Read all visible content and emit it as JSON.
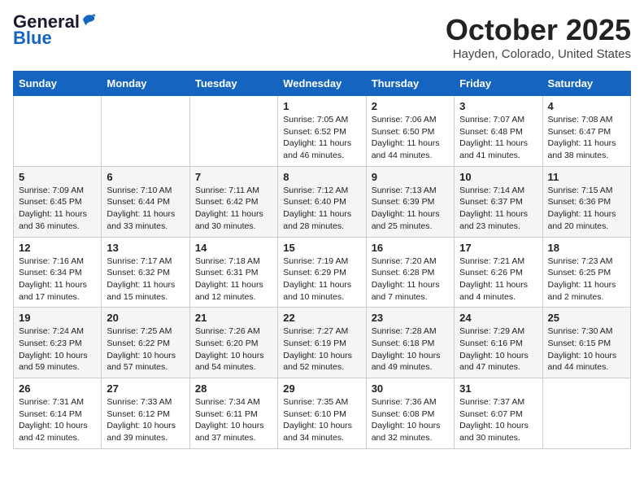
{
  "header": {
    "logo_general": "General",
    "logo_blue": "Blue",
    "month_title": "October 2025",
    "location": "Hayden, Colorado, United States"
  },
  "weekdays": [
    "Sunday",
    "Monday",
    "Tuesday",
    "Wednesday",
    "Thursday",
    "Friday",
    "Saturday"
  ],
  "weeks": [
    [
      {
        "day": "",
        "info": ""
      },
      {
        "day": "",
        "info": ""
      },
      {
        "day": "",
        "info": ""
      },
      {
        "day": "1",
        "info": "Sunrise: 7:05 AM\nSunset: 6:52 PM\nDaylight: 11 hours and 46 minutes."
      },
      {
        "day": "2",
        "info": "Sunrise: 7:06 AM\nSunset: 6:50 PM\nDaylight: 11 hours and 44 minutes."
      },
      {
        "day": "3",
        "info": "Sunrise: 7:07 AM\nSunset: 6:48 PM\nDaylight: 11 hours and 41 minutes."
      },
      {
        "day": "4",
        "info": "Sunrise: 7:08 AM\nSunset: 6:47 PM\nDaylight: 11 hours and 38 minutes."
      }
    ],
    [
      {
        "day": "5",
        "info": "Sunrise: 7:09 AM\nSunset: 6:45 PM\nDaylight: 11 hours and 36 minutes."
      },
      {
        "day": "6",
        "info": "Sunrise: 7:10 AM\nSunset: 6:44 PM\nDaylight: 11 hours and 33 minutes."
      },
      {
        "day": "7",
        "info": "Sunrise: 7:11 AM\nSunset: 6:42 PM\nDaylight: 11 hours and 30 minutes."
      },
      {
        "day": "8",
        "info": "Sunrise: 7:12 AM\nSunset: 6:40 PM\nDaylight: 11 hours and 28 minutes."
      },
      {
        "day": "9",
        "info": "Sunrise: 7:13 AM\nSunset: 6:39 PM\nDaylight: 11 hours and 25 minutes."
      },
      {
        "day": "10",
        "info": "Sunrise: 7:14 AM\nSunset: 6:37 PM\nDaylight: 11 hours and 23 minutes."
      },
      {
        "day": "11",
        "info": "Sunrise: 7:15 AM\nSunset: 6:36 PM\nDaylight: 11 hours and 20 minutes."
      }
    ],
    [
      {
        "day": "12",
        "info": "Sunrise: 7:16 AM\nSunset: 6:34 PM\nDaylight: 11 hours and 17 minutes."
      },
      {
        "day": "13",
        "info": "Sunrise: 7:17 AM\nSunset: 6:32 PM\nDaylight: 11 hours and 15 minutes."
      },
      {
        "day": "14",
        "info": "Sunrise: 7:18 AM\nSunset: 6:31 PM\nDaylight: 11 hours and 12 minutes."
      },
      {
        "day": "15",
        "info": "Sunrise: 7:19 AM\nSunset: 6:29 PM\nDaylight: 11 hours and 10 minutes."
      },
      {
        "day": "16",
        "info": "Sunrise: 7:20 AM\nSunset: 6:28 PM\nDaylight: 11 hours and 7 minutes."
      },
      {
        "day": "17",
        "info": "Sunrise: 7:21 AM\nSunset: 6:26 PM\nDaylight: 11 hours and 4 minutes."
      },
      {
        "day": "18",
        "info": "Sunrise: 7:23 AM\nSunset: 6:25 PM\nDaylight: 11 hours and 2 minutes."
      }
    ],
    [
      {
        "day": "19",
        "info": "Sunrise: 7:24 AM\nSunset: 6:23 PM\nDaylight: 10 hours and 59 minutes."
      },
      {
        "day": "20",
        "info": "Sunrise: 7:25 AM\nSunset: 6:22 PM\nDaylight: 10 hours and 57 minutes."
      },
      {
        "day": "21",
        "info": "Sunrise: 7:26 AM\nSunset: 6:20 PM\nDaylight: 10 hours and 54 minutes."
      },
      {
        "day": "22",
        "info": "Sunrise: 7:27 AM\nSunset: 6:19 PM\nDaylight: 10 hours and 52 minutes."
      },
      {
        "day": "23",
        "info": "Sunrise: 7:28 AM\nSunset: 6:18 PM\nDaylight: 10 hours and 49 minutes."
      },
      {
        "day": "24",
        "info": "Sunrise: 7:29 AM\nSunset: 6:16 PM\nDaylight: 10 hours and 47 minutes."
      },
      {
        "day": "25",
        "info": "Sunrise: 7:30 AM\nSunset: 6:15 PM\nDaylight: 10 hours and 44 minutes."
      }
    ],
    [
      {
        "day": "26",
        "info": "Sunrise: 7:31 AM\nSunset: 6:14 PM\nDaylight: 10 hours and 42 minutes."
      },
      {
        "day": "27",
        "info": "Sunrise: 7:33 AM\nSunset: 6:12 PM\nDaylight: 10 hours and 39 minutes."
      },
      {
        "day": "28",
        "info": "Sunrise: 7:34 AM\nSunset: 6:11 PM\nDaylight: 10 hours and 37 minutes."
      },
      {
        "day": "29",
        "info": "Sunrise: 7:35 AM\nSunset: 6:10 PM\nDaylight: 10 hours and 34 minutes."
      },
      {
        "day": "30",
        "info": "Sunrise: 7:36 AM\nSunset: 6:08 PM\nDaylight: 10 hours and 32 minutes."
      },
      {
        "day": "31",
        "info": "Sunrise: 7:37 AM\nSunset: 6:07 PM\nDaylight: 10 hours and 30 minutes."
      },
      {
        "day": "",
        "info": ""
      }
    ]
  ]
}
